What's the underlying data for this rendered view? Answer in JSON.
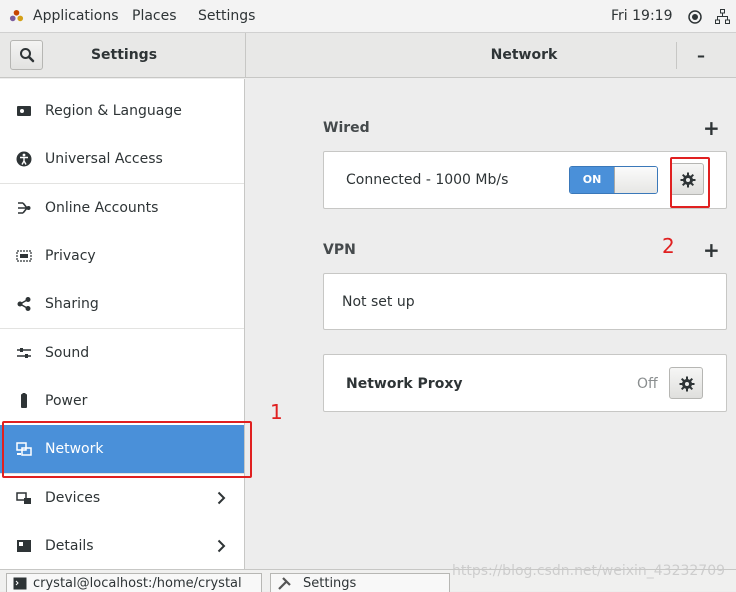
{
  "top_panel": {
    "applications": "Applications",
    "places": "Places",
    "settings": "Settings",
    "clock": "Fri 19:19"
  },
  "header": {
    "left_title": "Settings",
    "right_title": "Network",
    "minimize": "–"
  },
  "sidebar": {
    "items": [
      {
        "label": "Region & Language",
        "icon": "region-icon"
      },
      {
        "label": "Universal Access",
        "icon": "accessibility-icon"
      },
      {
        "label": "Online Accounts",
        "icon": "online-accounts-icon"
      },
      {
        "label": "Privacy",
        "icon": "privacy-icon"
      },
      {
        "label": "Sharing",
        "icon": "sharing-icon"
      },
      {
        "label": "Sound",
        "icon": "sound-icon"
      },
      {
        "label": "Power",
        "icon": "power-icon"
      },
      {
        "label": "Network",
        "icon": "network-icon",
        "selected": true
      },
      {
        "label": "Devices",
        "icon": "devices-icon",
        "chevron": true
      },
      {
        "label": "Details",
        "icon": "details-icon",
        "chevron": true
      }
    ]
  },
  "main": {
    "wired_label": "Wired",
    "wired_status": "Connected - 1000 Mb/s",
    "switch_on": "ON",
    "vpn_label": "VPN",
    "vpn_status": "Not set up",
    "proxy_label": "Network Proxy",
    "proxy_status": "Off",
    "plus": "+"
  },
  "annotations": {
    "one": "1",
    "two": "2"
  },
  "taskbar": {
    "terminal": "crystal@localhost:/home/crystal",
    "settings": "Settings"
  },
  "watermark": "https://blog.csdn.net/weixin_43232709",
  "colors": {
    "accent": "#4a90d9",
    "annotation": "#e02020"
  }
}
